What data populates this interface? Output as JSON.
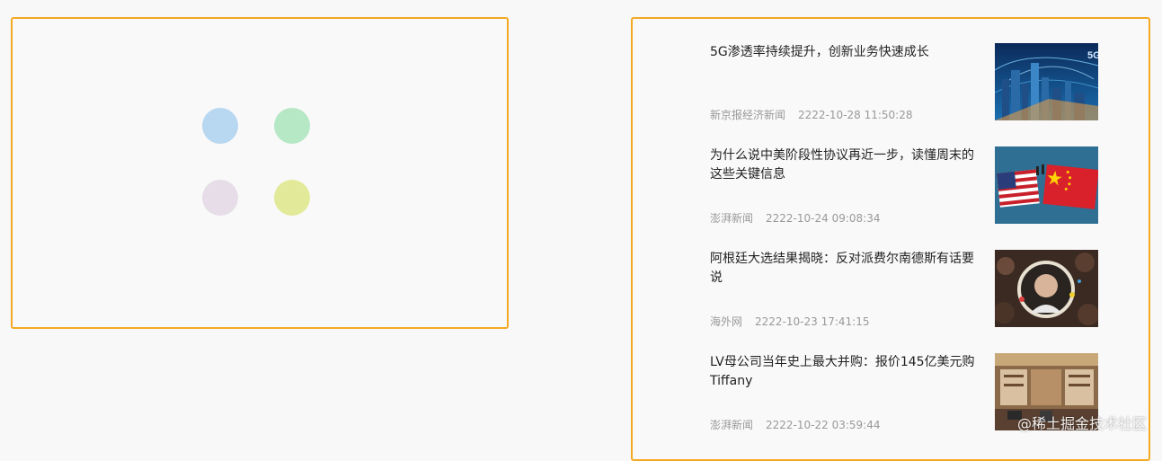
{
  "loader": {
    "dots": [
      {
        "color": "#b8d7f0"
      },
      {
        "color": "#b6e8c6"
      },
      {
        "color": "#e6dde8"
      },
      {
        "color": "#e2ea9a"
      }
    ]
  },
  "accent_color": "#f4a923",
  "news": [
    {
      "title": "5G渗透率持续提升，创新业务快速成长",
      "source": "新京报经济新闻",
      "time": "2222-10-28 11:50:28",
      "thumb": "city-network-image"
    },
    {
      "title": "为什么说中美阶段性协议再近一步，读懂周末的这些关键信息",
      "source": "澎湃新闻",
      "time": "2222-10-24 09:08:34",
      "thumb": "us-china-flags-image"
    },
    {
      "title": "阿根廷大选结果揭晓：反对派费尔南德斯有话要说",
      "source": "海外网",
      "time": "2222-10-23 17:41:15",
      "thumb": "election-crowd-image"
    },
    {
      "title": "LV母公司当年史上最大并购：报价145亿美元购Tiffany",
      "source": "澎湃新闻",
      "time": "2222-10-22 03:59:44",
      "thumb": "luxury-store-image"
    }
  ],
  "watermark": "@稀土掘金技术社区",
  "thumb_labels": {
    "five_g": "5G"
  }
}
